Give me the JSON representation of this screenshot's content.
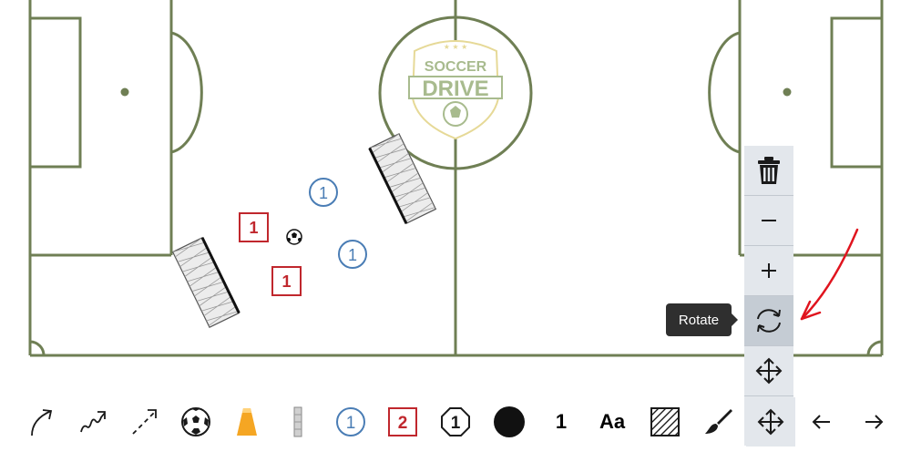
{
  "logo": {
    "line1": "SOCCER",
    "line2": "DRIVE"
  },
  "colors": {
    "pitch_line": "#6f7f54",
    "team_blue": "#4a7db5",
    "team_red": "#c0272d",
    "cone_orange": "#f5a623",
    "annotation_red": "#e0141e",
    "tooltip_bg": "#2f2f2f",
    "menu_bg": "#e3e7ec"
  },
  "field_players": [
    {
      "team": "blue",
      "number": "1"
    },
    {
      "team": "blue",
      "number": "1"
    },
    {
      "team": "red",
      "number": "1"
    },
    {
      "team": "red",
      "number": "1"
    }
  ],
  "context_menu": {
    "items": [
      {
        "icon": "trash-icon",
        "action": "delete"
      },
      {
        "icon": "minus-icon",
        "action": "decrease-size"
      },
      {
        "icon": "plus-icon",
        "action": "increase-size"
      },
      {
        "icon": "rotate-icon",
        "action": "rotate"
      },
      {
        "icon": "move-icon",
        "action": "move"
      }
    ],
    "tooltip": "Rotate"
  },
  "toolbar": {
    "blue_player_number": "1",
    "red_player_number": "2",
    "octagon_player_number": "1",
    "number_tool_label": "1",
    "text_tool_label": "Aa",
    "items": [
      "curved-arrow-icon",
      "dribble-arrow-icon",
      "dashed-arrow-icon",
      "ball-icon",
      "cone-icon",
      "pole-icon",
      "blue-player-icon",
      "red-player-icon",
      "octagon-player-icon",
      "black-dot-icon",
      "number-tool",
      "text-tool",
      "hatched-area-icon",
      "brush-icon",
      "move-icon",
      "undo-arrow-icon",
      "redo-arrow-icon"
    ]
  }
}
